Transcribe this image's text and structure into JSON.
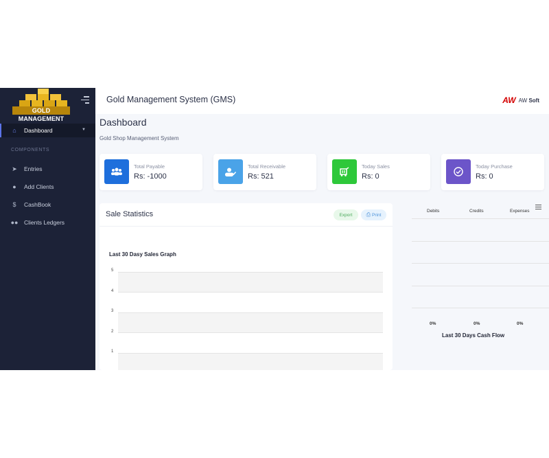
{
  "sidebar": {
    "logo_text": "GOLD MANAGEMENT",
    "items": [
      {
        "label": "Dashboard",
        "icon": "home-icon"
      },
      {
        "label": "Entries",
        "icon": "tag-icon"
      },
      {
        "label": "Add Clients",
        "icon": "user-icon"
      },
      {
        "label": "CashBook",
        "icon": "dollar-icon"
      },
      {
        "label": "Clients Ledgers",
        "icon": "users-icon"
      }
    ],
    "section_label": "COMPONENTS"
  },
  "header": {
    "title": "Gold Management System (GMS)",
    "brand_mark": "AW",
    "brand_name_prefix": "AW",
    "brand_name_suffix": "Soft"
  },
  "page": {
    "title": "Dashboard",
    "subtitle": "Gold Shop Management System"
  },
  "cards": [
    {
      "label": "Total Payable",
      "value": "Rs: -1000",
      "color": "#1e6fdc",
      "icon": "users-icon"
    },
    {
      "label": "Total Receivable",
      "value": "Rs: 521",
      "color": "#4aa3e8",
      "icon": "user-check-icon"
    },
    {
      "label": "Today Sales",
      "value": "Rs: 0",
      "color": "#2ec83a",
      "icon": "cart-icon"
    },
    {
      "label": "Today Purchase",
      "value": "Rs: 0",
      "color": "#6c55c9",
      "icon": "check-circle-icon"
    }
  ],
  "stats": {
    "title": "Sale Statistics",
    "export_label": "Export",
    "print_label": "Print",
    "graph_title": "Last 30 Dasy Sales Graph",
    "y_ticks": [
      "5",
      "4",
      "3",
      "2",
      "1"
    ]
  },
  "cash": {
    "headers": [
      "Debits",
      "Credits",
      "Expenses"
    ],
    "percentages": [
      "0%",
      "0%",
      "0%"
    ],
    "title": "Last 30 Days Cash Flow"
  },
  "chart_data": [
    {
      "type": "line",
      "title": "Last 30 Dasy Sales Graph",
      "y_ticks": [
        5,
        4,
        3,
        2,
        1
      ],
      "series": [],
      "grid": true
    },
    {
      "type": "bar",
      "title": "Last 30 Days Cash Flow",
      "categories": [
        "Debits",
        "Credits",
        "Expenses"
      ],
      "values": [
        0,
        0,
        0
      ]
    }
  ]
}
